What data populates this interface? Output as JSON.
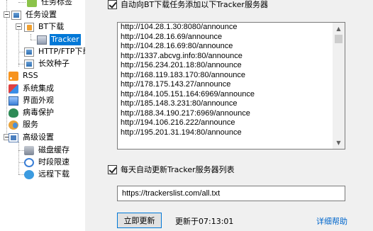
{
  "tree": {
    "items": [
      {
        "label": "任务标签",
        "icon": "tag-icon"
      },
      {
        "label": "任务设置",
        "icon": "task-settings-icon"
      },
      {
        "label": "BT下载",
        "icon": "bt-download-icon"
      },
      {
        "label": "Tracker",
        "icon": "tracker-server-icon"
      },
      {
        "label": "HTTP/FTP下载",
        "icon": "http-ftp-icon"
      },
      {
        "label": "长效种子",
        "icon": "seed-icon"
      },
      {
        "label": "RSS",
        "icon": "rss-icon"
      },
      {
        "label": "系统集成",
        "icon": "system-integration-icon"
      },
      {
        "label": "界面外观",
        "icon": "appearance-icon"
      },
      {
        "label": "病毒保护",
        "icon": "virus-protection-icon"
      },
      {
        "label": "服务",
        "icon": "service-icon"
      },
      {
        "label": "高级设置",
        "icon": "advanced-settings-icon"
      },
      {
        "label": "磁盘缓存",
        "icon": "disk-cache-icon"
      },
      {
        "label": "时段限速",
        "icon": "speed-limit-clock-icon"
      },
      {
        "label": "远程下载",
        "icon": "remote-download-icon"
      }
    ],
    "selected_index": 3
  },
  "panel": {
    "auto_add_label": "自动向BT下载任务添加以下Tracker服务器",
    "auto_add_checked": true,
    "trackers": [
      "http://104.28.1.30:8080/announce",
      "http://104.28.16.69/announce",
      "http://104.28.16.69:80/announce",
      "http://1337.abcvg.info:80/announce",
      "http://156.234.201.18:80/announce",
      "http://168.119.183.170:80/announce",
      "http://178.175.143.27/announce",
      "http://184.105.151.164:6969/announce",
      "http://185.148.3.231:80/announce",
      "http://188.34.190.217:6969/announce",
      "http://194.106.216.222/announce",
      "http://195.201.31.194:80/announce"
    ],
    "daily_update_label": "每天自动更新Tracker服务器列表",
    "daily_update_checked": true,
    "list_url": "https://trackerslist.com/all.txt",
    "update_button_label": "立即更新",
    "updated_at_text": "更新于07:13:01",
    "help_link_label": "详细帮助"
  }
}
